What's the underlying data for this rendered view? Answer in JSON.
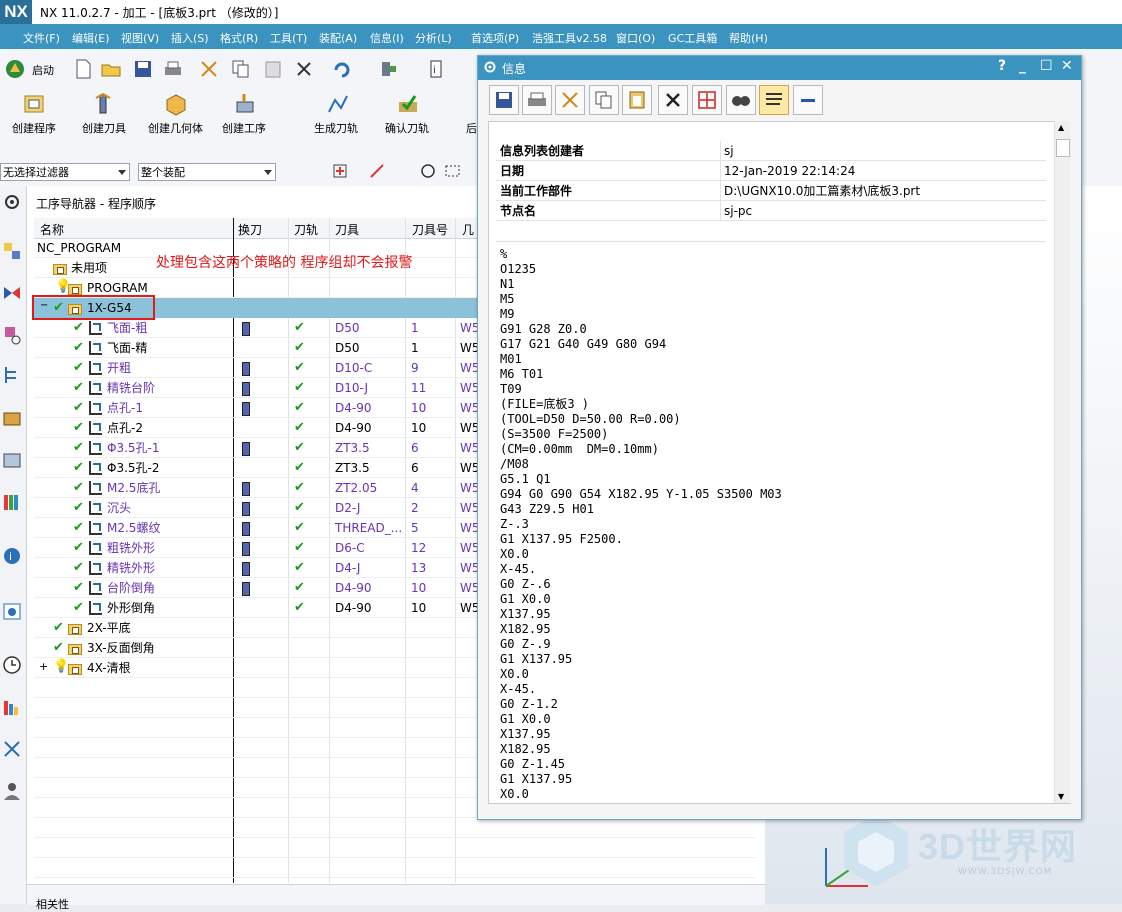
{
  "window": {
    "logo": "NX",
    "title": "NX 11.0.2.7 - 加工 - [底板3.prt （修改的）]"
  },
  "menu": [
    {
      "label": "文件(F)",
      "name": "menu-file"
    },
    {
      "label": "编辑(E)",
      "name": "menu-edit"
    },
    {
      "label": "视图(V)",
      "name": "menu-view"
    },
    {
      "label": "插入(S)",
      "name": "menu-insert"
    },
    {
      "label": "格式(R)",
      "name": "menu-format"
    },
    {
      "label": "工具(T)",
      "name": "menu-tools"
    },
    {
      "label": "装配(A)",
      "name": "menu-assembly"
    },
    {
      "label": "信息(I)",
      "name": "menu-info"
    },
    {
      "label": "分析(L)",
      "name": "menu-analysis"
    },
    {
      "label": "首选项(P)",
      "name": "menu-preferences"
    },
    {
      "label": "浩强工具v2.58",
      "name": "menu-haoqiang"
    },
    {
      "label": "窗口(O)",
      "name": "menu-window"
    },
    {
      "label": "GC工具箱",
      "name": "menu-gc"
    },
    {
      "label": "帮助(H)",
      "name": "menu-help"
    }
  ],
  "toolbar": {
    "start_label": "启动",
    "create_program": "创建程序",
    "create_tool": "创建刀具",
    "create_geometry": "创建几何体",
    "create_method": "创建工序",
    "generate_toolpath": "生成刀轨",
    "confirm_toolpath": "确认刀轨",
    "truncated": "后"
  },
  "filters": {
    "selection_filter": "无选择过滤器",
    "assembly_scope": "整个装配"
  },
  "navigator": {
    "title": "工序导航器 - 程序顺序",
    "columns": [
      "名称",
      "换刀",
      "刀轨",
      "刀具",
      "刀具号",
      "几"
    ],
    "root": "NC_PROGRAM",
    "unused": "未用项",
    "program": "PROGRAM",
    "group1": "1X-G54",
    "ops": [
      {
        "name": "飞面-粗",
        "tool": "D50",
        "num": "1",
        "geo": "W5",
        "purple": true,
        "change": true
      },
      {
        "name": "飞面-精",
        "tool": "D50",
        "num": "1",
        "geo": "W5",
        "purple": false,
        "change": false
      },
      {
        "name": "开粗",
        "tool": "D10-C",
        "num": "9",
        "geo": "W5",
        "purple": true,
        "change": true
      },
      {
        "name": "精铣台阶",
        "tool": "D10-J",
        "num": "11",
        "geo": "W5",
        "purple": true,
        "change": true
      },
      {
        "name": "点孔-1",
        "tool": "D4-90",
        "num": "10",
        "geo": "W5",
        "purple": true,
        "change": true
      },
      {
        "name": "点孔-2",
        "tool": "D4-90",
        "num": "10",
        "geo": "W5",
        "purple": false,
        "change": false
      },
      {
        "name": "Φ3.5孔-1",
        "tool": "ZT3.5",
        "num": "6",
        "geo": "W5",
        "purple": true,
        "change": true
      },
      {
        "name": "Φ3.5孔-2",
        "tool": "ZT3.5",
        "num": "6",
        "geo": "W5",
        "purple": false,
        "change": false
      },
      {
        "name": "M2.5底孔",
        "tool": "ZT2.05",
        "num": "4",
        "geo": "W5",
        "purple": true,
        "change": true
      },
      {
        "name": "沉头",
        "tool": "D2-J",
        "num": "2",
        "geo": "W5",
        "purple": true,
        "change": true
      },
      {
        "name": "M2.5螺纹",
        "tool": "THREAD_...",
        "num": "5",
        "geo": "W5",
        "purple": true,
        "change": true
      },
      {
        "name": "粗铣外形",
        "tool": "D6-C",
        "num": "12",
        "geo": "W5",
        "purple": true,
        "change": true
      },
      {
        "name": "精铣外形",
        "tool": "D4-J",
        "num": "13",
        "geo": "W5",
        "purple": true,
        "change": true
      },
      {
        "name": "台阶倒角",
        "tool": "D4-90",
        "num": "10",
        "geo": "W5",
        "purple": true,
        "change": true
      },
      {
        "name": "外形倒角",
        "tool": "D4-90",
        "num": "10",
        "geo": "W5",
        "purple": false,
        "change": false
      }
    ],
    "groups": [
      "2X-平底",
      "3X-反面倒角",
      "4X-清根"
    ],
    "bottom_label": "相关性"
  },
  "annotation": "处理包含这两个策略的 程序组却不会报警",
  "info_dialog": {
    "title": "信息",
    "help": "?",
    "rows": [
      {
        "label": "信息列表创建者",
        "value": "sj"
      },
      {
        "label": "日期",
        "value": "12-Jan-2019 22:14:24"
      },
      {
        "label": "当前工作部件",
        "value": "D:\\UGNX10.0加工篇素材\\底板3.prt"
      },
      {
        "label": "节点名",
        "value": "sj-pc"
      }
    ],
    "code": [
      "%",
      "O1235",
      "N1",
      "M5",
      "M9",
      "G91 G28 Z0.0",
      "G17 G21 G40 G49 G80 G94",
      "M01",
      "M6 T01",
      "T09",
      "(FILE=底板3 )",
      "(TOOL=D50 D=50.00 R=0.00)",
      "(S=3500 F=2500)",
      "(CM=0.00mm  DM=0.10mm)",
      "/M08",
      "G5.1 Q1",
      "G94 G0 G90 G54 X182.95 Y-1.05 S3500 M03",
      "G43 Z29.5 H01",
      "Z-.3",
      "G1 X137.95 F2500.",
      "X0.0",
      "X-45.",
      "G0 Z-.6",
      "G1 X0.0",
      "X137.95",
      "X182.95",
      "G0 Z-.9",
      "G1 X137.95",
      "X0.0",
      "X-45.",
      "G0 Z-1.2",
      "G1 X0.0",
      "X137.95",
      "X182.95",
      "G0 Z-1.45",
      "G1 X137.95",
      "X0.0"
    ]
  },
  "watermark": {
    "main": "3D世界网",
    "sub": "WWW.3DSJW.COM"
  },
  "colors": {
    "menubar": "#3b93bf",
    "selection": "#8cc2d9",
    "annotation": "#e11a1a",
    "op_purple": "#6a32b8",
    "check_green": "#1a9a1a"
  }
}
